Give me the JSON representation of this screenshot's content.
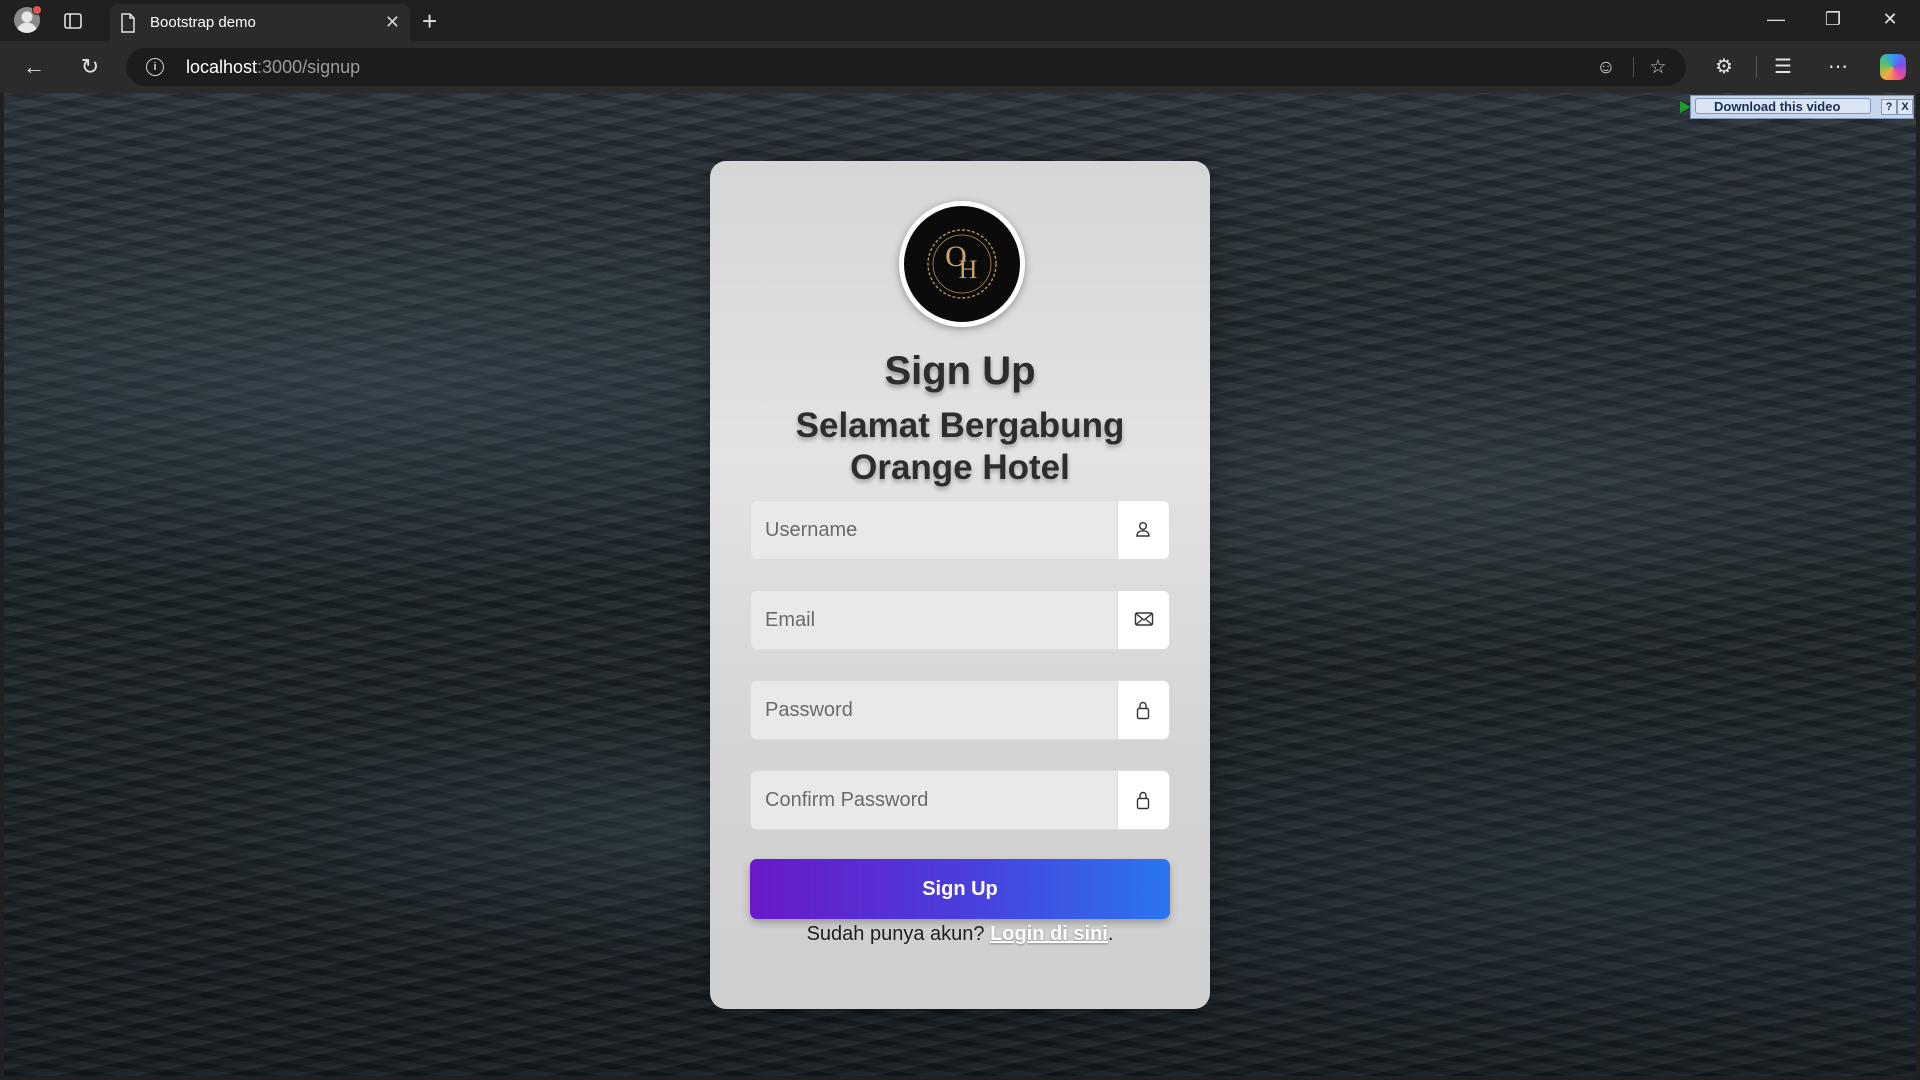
{
  "browser": {
    "tab_title": "Bootstrap demo",
    "tab_close": "✕",
    "new_tab": "+",
    "url_host": "localhost",
    "url_path": ":3000/signup",
    "window_controls": {
      "minimize": "—",
      "restore": "❐",
      "close": "✕"
    },
    "nav": {
      "back": "←",
      "reload": "↻"
    },
    "info": "i",
    "toolbar_icons": {
      "read_mode": "☺",
      "favorite": "☆",
      "extensions": "⚙",
      "favorites": "☰",
      "more": "⋯"
    }
  },
  "overlay": {
    "download_label": "Download this video",
    "help": "?",
    "close": "X"
  },
  "card": {
    "title": "Sign Up",
    "subtitle_line1": "Selamat Bergabung",
    "subtitle_line2": "Orange Hotel",
    "logo_letters": "OH",
    "fields": {
      "username_placeholder": "Username",
      "email_placeholder": "Email",
      "password_placeholder": "Password",
      "confirm_placeholder": "Confirm Password"
    },
    "icons": {
      "username": "user-icon",
      "email": "envelope-icon",
      "password": "lock-icon",
      "confirm": "lock-icon"
    },
    "submit_label": "Sign Up",
    "login_prompt": "Sudah punya akun?",
    "login_link": "Login di sini",
    "login_suffix": "."
  },
  "colors": {
    "button_gradient_start": "#6a19c9",
    "button_gradient_end": "#2a75f0",
    "card_bg": "#e0e0e1",
    "logo_bg": "#0b0b0b",
    "logo_gold": "#b8935a"
  }
}
